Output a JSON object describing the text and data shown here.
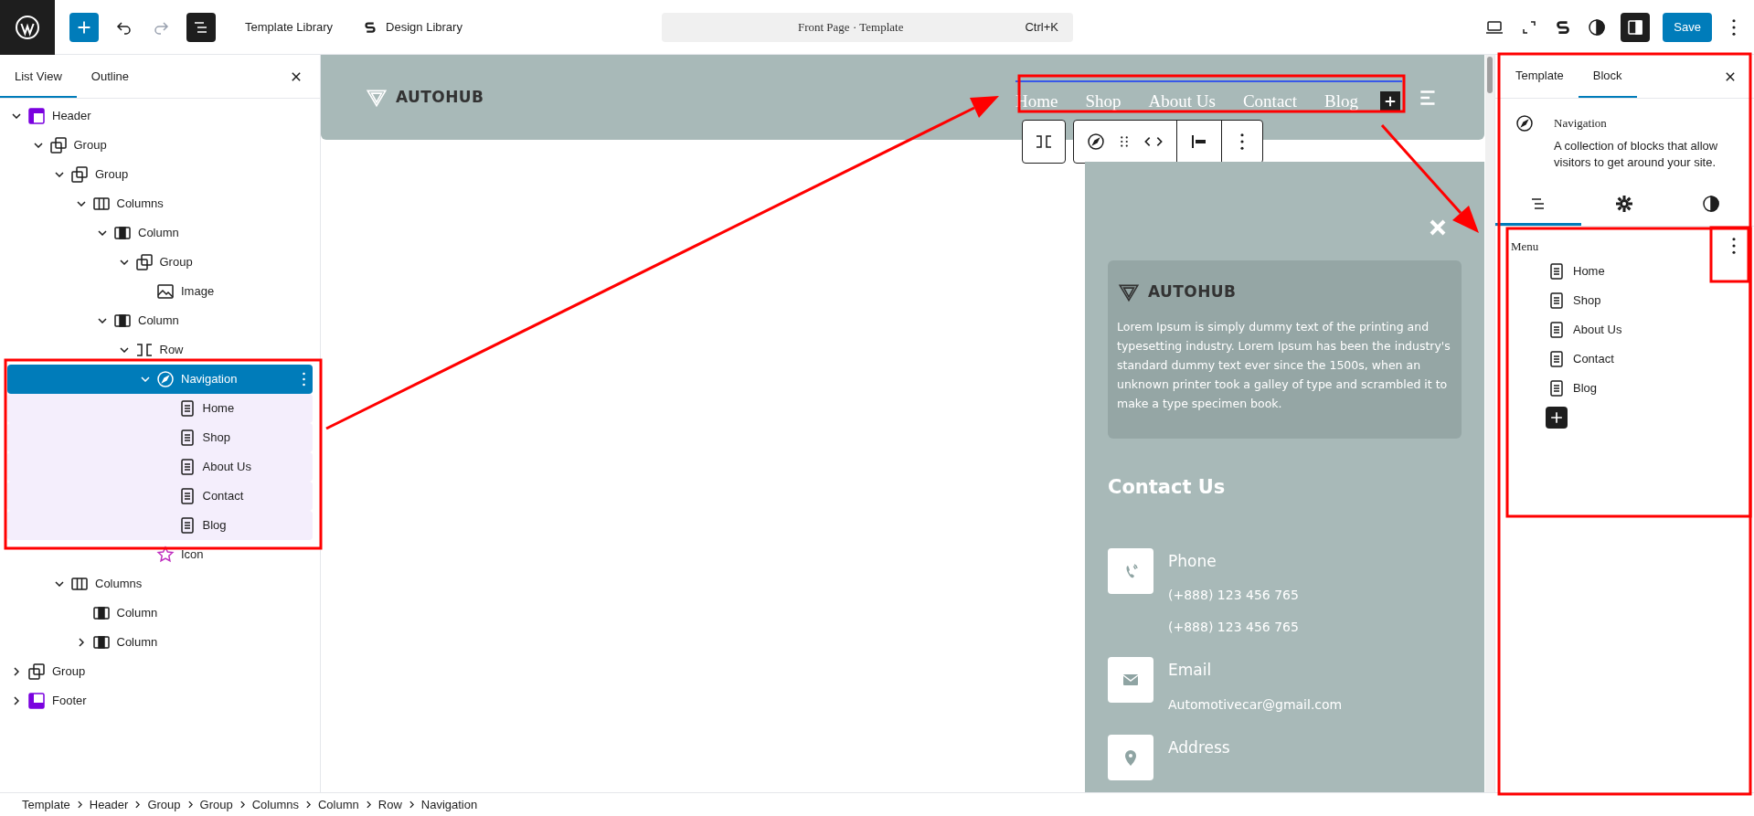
{
  "top_bar": {
    "list_view_open": true,
    "redo_enabled": false,
    "links": [
      "Template Library",
      "Design Library"
    ],
    "command": {
      "title": "Front Page · Template",
      "shortcut": "Ctrl+K"
    },
    "settings_open": true,
    "save_label": "Save"
  },
  "list_panel": {
    "tabs": [
      {
        "label": "List View",
        "selected": true
      },
      {
        "label": "Outline",
        "selected": false
      }
    ],
    "tree": [
      {
        "label": "Header",
        "kind": "header",
        "expanded": true,
        "selected": false,
        "children": [
          {
            "label": "Group",
            "kind": "group",
            "expanded": true,
            "selected": false,
            "children": [
              {
                "label": "Group",
                "kind": "group",
                "expanded": true,
                "selected": false,
                "children": [
                  {
                    "label": "Columns",
                    "kind": "columns",
                    "expanded": true,
                    "selected": false,
                    "children": [
                      {
                        "label": "Column",
                        "kind": "column",
                        "expanded": true,
                        "selected": false,
                        "children": [
                          {
                            "label": "Group",
                            "kind": "group",
                            "expanded": true,
                            "selected": false,
                            "children": [
                              {
                                "label": "Image",
                                "kind": "image",
                                "selected": false
                              }
                            ]
                          }
                        ]
                      },
                      {
                        "label": "Column",
                        "kind": "column",
                        "expanded": true,
                        "selected": false,
                        "children": [
                          {
                            "label": "Row",
                            "kind": "row",
                            "expanded": true,
                            "selected": false,
                            "children": [
                              {
                                "label": "Navigation",
                                "kind": "navigation",
                                "expanded": true,
                                "selected": true,
                                "children": [
                                  {
                                    "label": "Home",
                                    "kind": "page",
                                    "selected": false
                                  },
                                  {
                                    "label": "Shop",
                                    "kind": "page",
                                    "selected": false
                                  },
                                  {
                                    "label": "About Us",
                                    "kind": "page",
                                    "selected": false
                                  },
                                  {
                                    "label": "Contact",
                                    "kind": "page",
                                    "selected": false
                                  },
                                  {
                                    "label": "Blog",
                                    "kind": "page",
                                    "selected": false
                                  }
                                ]
                              },
                              {
                                "label": "Icon",
                                "kind": "icon",
                                "selected": false
                              }
                            ]
                          }
                        ]
                      }
                    ]
                  }
                ]
              },
              {
                "label": "Columns",
                "kind": "columns",
                "expanded": true,
                "selected": false,
                "children": [
                  {
                    "label": "Column",
                    "kind": "column",
                    "selected": false
                  },
                  {
                    "label": "Column",
                    "kind": "column",
                    "expanded": false,
                    "selected": false
                  }
                ]
              }
            ]
          }
        ]
      },
      {
        "label": "Group",
        "kind": "group",
        "expanded": false,
        "selected": false
      },
      {
        "label": "Footer",
        "kind": "footer",
        "expanded": false,
        "selected": false
      }
    ]
  },
  "canvas": {
    "logo": "AUTOHUB",
    "nav": [
      "Home",
      "Shop",
      "About Us",
      "Contact",
      "Blog"
    ],
    "mobile_menu": {
      "logo": "AUTOHUB",
      "description": "Lorem Ipsum is simply dummy text of the printing and typesetting industry. Lorem Ipsum has been the industry's standard dummy text ever since the 1500s, when an unknown printer took a galley of type and scrambled it to make a type specimen book.",
      "contact_heading": "Contact Us",
      "contacts": [
        {
          "kind": "phone",
          "label": "Phone",
          "lines": [
            "(+888) 123 456 765",
            "(+888) 123 456 765"
          ]
        },
        {
          "kind": "email",
          "label": "Email",
          "lines": [
            "Automotivecar@gmail.com"
          ]
        },
        {
          "kind": "address",
          "label": "Address"
        }
      ]
    }
  },
  "sidebar": {
    "tabs": [
      {
        "label": "Template",
        "selected": false
      },
      {
        "label": "Block",
        "selected": true
      }
    ],
    "block": {
      "title": "Navigation",
      "description": "A collection of blocks that allow visitors to get around your site."
    },
    "subtabs": [
      {
        "kind": "list",
        "selected": true
      },
      {
        "kind": "settings",
        "selected": false
      },
      {
        "kind": "styles",
        "selected": false
      }
    ],
    "menu": {
      "label": "Menu",
      "items": [
        "Home",
        "Shop",
        "About Us",
        "Contact",
        "Blog"
      ]
    }
  },
  "breadcrumb": [
    "Template",
    "Header",
    "Group",
    "Group",
    "Columns",
    "Column",
    "Row",
    "Navigation"
  ]
}
